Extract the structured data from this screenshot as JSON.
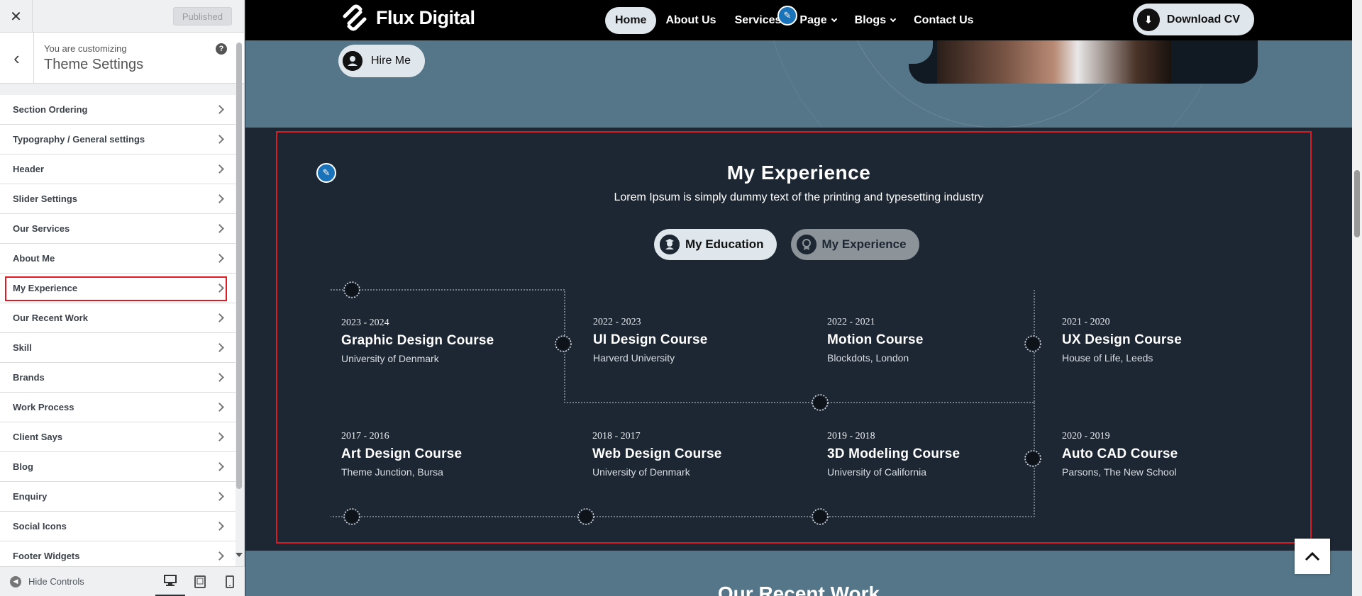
{
  "customizer": {
    "published_label": "Published",
    "customizing_label": "You are customizing",
    "section_title": "Theme Settings",
    "menu_items": [
      {
        "label": "Section Ordering",
        "active": false
      },
      {
        "label": "Typography / General settings",
        "active": false
      },
      {
        "label": "Header",
        "active": false
      },
      {
        "label": "Slider Settings",
        "active": false
      },
      {
        "label": "Our Services",
        "active": false
      },
      {
        "label": "About Me",
        "active": false
      },
      {
        "label": "My Experience",
        "active": true
      },
      {
        "label": "Our Recent Work",
        "active": false
      },
      {
        "label": "Skill",
        "active": false
      },
      {
        "label": "Brands",
        "active": false
      },
      {
        "label": "Work Process",
        "active": false
      },
      {
        "label": "Client Says",
        "active": false
      },
      {
        "label": "Blog",
        "active": false
      },
      {
        "label": "Enquiry",
        "active": false
      },
      {
        "label": "Social Icons",
        "active": false
      },
      {
        "label": "Footer Widgets",
        "active": false
      }
    ],
    "hide_controls_label": "Hide Controls",
    "devices": [
      "desktop",
      "tablet",
      "mobile"
    ],
    "selected_device": "desktop"
  },
  "site": {
    "brand": "Flux Digital",
    "nav": [
      {
        "label": "Home",
        "active": true,
        "dropdown": false
      },
      {
        "label": "About Us",
        "active": false,
        "dropdown": false
      },
      {
        "label": "Services",
        "active": false,
        "dropdown": false
      },
      {
        "label": "Page",
        "active": false,
        "dropdown": true
      },
      {
        "label": "Blogs",
        "active": false,
        "dropdown": true
      },
      {
        "label": "Contact Us",
        "active": false,
        "dropdown": false
      }
    ],
    "download_cv_label": "Download CV",
    "hire_me_label": "Hire Me"
  },
  "experience": {
    "title": "My Experience",
    "subtitle": "Lorem Ipsum is simply dummy text of the printing and typesetting industry",
    "tabs": [
      {
        "label": "My Education",
        "active": true
      },
      {
        "label": "My Experience",
        "active": false
      }
    ],
    "row1": [
      {
        "years": "2023 - 2024",
        "title": "Graphic Design Course",
        "school": "University of Denmark"
      },
      {
        "years": "2022 - 2023",
        "title": "UI Design Course",
        "school": "Harverd University"
      },
      {
        "years": "2022 - 2021",
        "title": "Motion Course",
        "school": "Blockdots, London"
      },
      {
        "years": "2021 - 2020",
        "title": "UX Design Course",
        "school": "House of Life, Leeds"
      }
    ],
    "row2": [
      {
        "years": "2017 - 2016",
        "title": "Art Design Course",
        "school": "Theme Junction, Bursa"
      },
      {
        "years": "2018 - 2017",
        "title": "Web Design Course",
        "school": "University of Denmark"
      },
      {
        "years": "2019 - 2018",
        "title": "3D Modeling Course",
        "school": "University of California"
      },
      {
        "years": "2020 - 2019",
        "title": "Auto CAD Course",
        "school": "Parsons, The New School"
      }
    ]
  },
  "next_section_title": "Our Recent Work",
  "colors": {
    "accent_red": "#d81b24",
    "section_bg": "#1d2733",
    "page_bg": "#557688",
    "edit_blue": "#1a73b8"
  }
}
